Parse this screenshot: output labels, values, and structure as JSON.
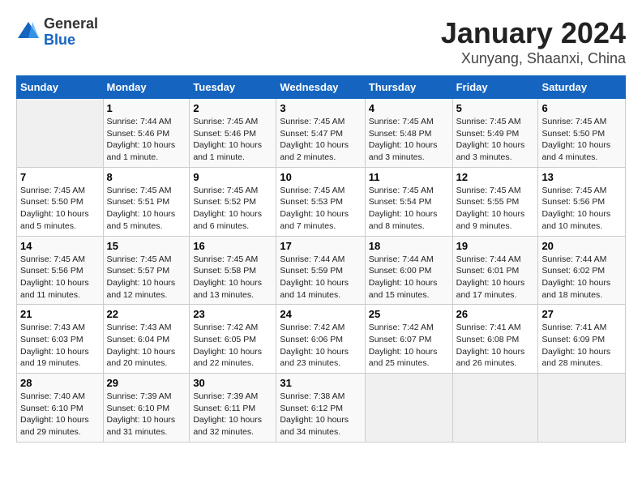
{
  "header": {
    "logo_general": "General",
    "logo_blue": "Blue",
    "title": "January 2024",
    "subtitle": "Xunyang, Shaanxi, China"
  },
  "calendar": {
    "columns": [
      "Sunday",
      "Monday",
      "Tuesday",
      "Wednesday",
      "Thursday",
      "Friday",
      "Saturday"
    ],
    "weeks": [
      [
        {
          "day": "",
          "info": ""
        },
        {
          "day": "1",
          "info": "Sunrise: 7:44 AM\nSunset: 5:46 PM\nDaylight: 10 hours\nand 1 minute."
        },
        {
          "day": "2",
          "info": "Sunrise: 7:45 AM\nSunset: 5:46 PM\nDaylight: 10 hours\nand 1 minute."
        },
        {
          "day": "3",
          "info": "Sunrise: 7:45 AM\nSunset: 5:47 PM\nDaylight: 10 hours\nand 2 minutes."
        },
        {
          "day": "4",
          "info": "Sunrise: 7:45 AM\nSunset: 5:48 PM\nDaylight: 10 hours\nand 3 minutes."
        },
        {
          "day": "5",
          "info": "Sunrise: 7:45 AM\nSunset: 5:49 PM\nDaylight: 10 hours\nand 3 minutes."
        },
        {
          "day": "6",
          "info": "Sunrise: 7:45 AM\nSunset: 5:50 PM\nDaylight: 10 hours\nand 4 minutes."
        }
      ],
      [
        {
          "day": "7",
          "info": "Sunrise: 7:45 AM\nSunset: 5:50 PM\nDaylight: 10 hours\nand 5 minutes."
        },
        {
          "day": "8",
          "info": "Sunrise: 7:45 AM\nSunset: 5:51 PM\nDaylight: 10 hours\nand 5 minutes."
        },
        {
          "day": "9",
          "info": "Sunrise: 7:45 AM\nSunset: 5:52 PM\nDaylight: 10 hours\nand 6 minutes."
        },
        {
          "day": "10",
          "info": "Sunrise: 7:45 AM\nSunset: 5:53 PM\nDaylight: 10 hours\nand 7 minutes."
        },
        {
          "day": "11",
          "info": "Sunrise: 7:45 AM\nSunset: 5:54 PM\nDaylight: 10 hours\nand 8 minutes."
        },
        {
          "day": "12",
          "info": "Sunrise: 7:45 AM\nSunset: 5:55 PM\nDaylight: 10 hours\nand 9 minutes."
        },
        {
          "day": "13",
          "info": "Sunrise: 7:45 AM\nSunset: 5:56 PM\nDaylight: 10 hours\nand 10 minutes."
        }
      ],
      [
        {
          "day": "14",
          "info": "Sunrise: 7:45 AM\nSunset: 5:56 PM\nDaylight: 10 hours\nand 11 minutes."
        },
        {
          "day": "15",
          "info": "Sunrise: 7:45 AM\nSunset: 5:57 PM\nDaylight: 10 hours\nand 12 minutes."
        },
        {
          "day": "16",
          "info": "Sunrise: 7:45 AM\nSunset: 5:58 PM\nDaylight: 10 hours\nand 13 minutes."
        },
        {
          "day": "17",
          "info": "Sunrise: 7:44 AM\nSunset: 5:59 PM\nDaylight: 10 hours\nand 14 minutes."
        },
        {
          "day": "18",
          "info": "Sunrise: 7:44 AM\nSunset: 6:00 PM\nDaylight: 10 hours\nand 15 minutes."
        },
        {
          "day": "19",
          "info": "Sunrise: 7:44 AM\nSunset: 6:01 PM\nDaylight: 10 hours\nand 17 minutes."
        },
        {
          "day": "20",
          "info": "Sunrise: 7:44 AM\nSunset: 6:02 PM\nDaylight: 10 hours\nand 18 minutes."
        }
      ],
      [
        {
          "day": "21",
          "info": "Sunrise: 7:43 AM\nSunset: 6:03 PM\nDaylight: 10 hours\nand 19 minutes."
        },
        {
          "day": "22",
          "info": "Sunrise: 7:43 AM\nSunset: 6:04 PM\nDaylight: 10 hours\nand 20 minutes."
        },
        {
          "day": "23",
          "info": "Sunrise: 7:42 AM\nSunset: 6:05 PM\nDaylight: 10 hours\nand 22 minutes."
        },
        {
          "day": "24",
          "info": "Sunrise: 7:42 AM\nSunset: 6:06 PM\nDaylight: 10 hours\nand 23 minutes."
        },
        {
          "day": "25",
          "info": "Sunrise: 7:42 AM\nSunset: 6:07 PM\nDaylight: 10 hours\nand 25 minutes."
        },
        {
          "day": "26",
          "info": "Sunrise: 7:41 AM\nSunset: 6:08 PM\nDaylight: 10 hours\nand 26 minutes."
        },
        {
          "day": "27",
          "info": "Sunrise: 7:41 AM\nSunset: 6:09 PM\nDaylight: 10 hours\nand 28 minutes."
        }
      ],
      [
        {
          "day": "28",
          "info": "Sunrise: 7:40 AM\nSunset: 6:10 PM\nDaylight: 10 hours\nand 29 minutes."
        },
        {
          "day": "29",
          "info": "Sunrise: 7:39 AM\nSunset: 6:10 PM\nDaylight: 10 hours\nand 31 minutes."
        },
        {
          "day": "30",
          "info": "Sunrise: 7:39 AM\nSunset: 6:11 PM\nDaylight: 10 hours\nand 32 minutes."
        },
        {
          "day": "31",
          "info": "Sunrise: 7:38 AM\nSunset: 6:12 PM\nDaylight: 10 hours\nand 34 minutes."
        },
        {
          "day": "",
          "info": ""
        },
        {
          "day": "",
          "info": ""
        },
        {
          "day": "",
          "info": ""
        }
      ]
    ]
  }
}
